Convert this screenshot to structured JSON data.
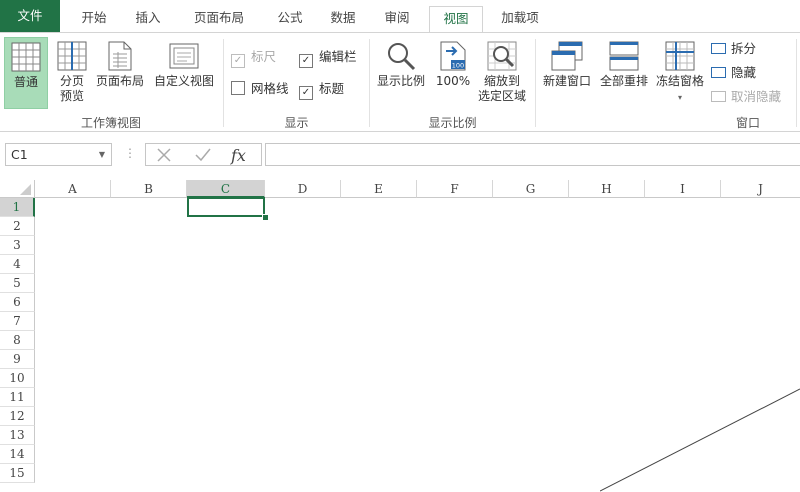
{
  "tabs": [
    {
      "label": "文件"
    },
    {
      "label": "开始"
    },
    {
      "label": "插入"
    },
    {
      "label": "页面布局"
    },
    {
      "label": "公式"
    },
    {
      "label": "数据"
    },
    {
      "label": "审阅"
    },
    {
      "label": "视图"
    },
    {
      "label": "加载项"
    }
  ],
  "ribbon": {
    "workbook_views": {
      "label": "工作簿视图",
      "normal": "普通",
      "page_break_1": "分页",
      "page_break_2": "预览",
      "page_layout": "页面布局",
      "custom_views": "自定义视图"
    },
    "show": {
      "label": "显示",
      "ruler": "标尺",
      "ruler_checked": true,
      "ruler_disabled": true,
      "formula_bar": "编辑栏",
      "formula_bar_checked": true,
      "gridlines": "网格线",
      "gridlines_checked": false,
      "headings": "标题",
      "headings_checked": true
    },
    "zoom": {
      "label": "显示比例",
      "zoom": "显示比例",
      "hundred": "100%",
      "hundred_badge": "100",
      "zoom_selection_1": "缩放到",
      "zoom_selection_2": "选定区域"
    },
    "window": {
      "label": "窗口",
      "new_window": "新建窗口",
      "arrange_all": "全部重排",
      "freeze_panes": "冻结窗格",
      "split": "拆分",
      "hide": "隐藏",
      "unhide": "取消隐藏"
    }
  },
  "formula_bar": {
    "name_box": "C1",
    "formula": ""
  },
  "grid": {
    "columns": [
      "A",
      "B",
      "C",
      "D",
      "E",
      "F",
      "G",
      "H",
      "I",
      "J"
    ],
    "rows": [
      "1",
      "2",
      "3",
      "4",
      "5",
      "6",
      "7",
      "8",
      "9",
      "10",
      "11",
      "12",
      "13",
      "14",
      "15"
    ],
    "selected_cell": "C1",
    "accent": "#217346"
  }
}
